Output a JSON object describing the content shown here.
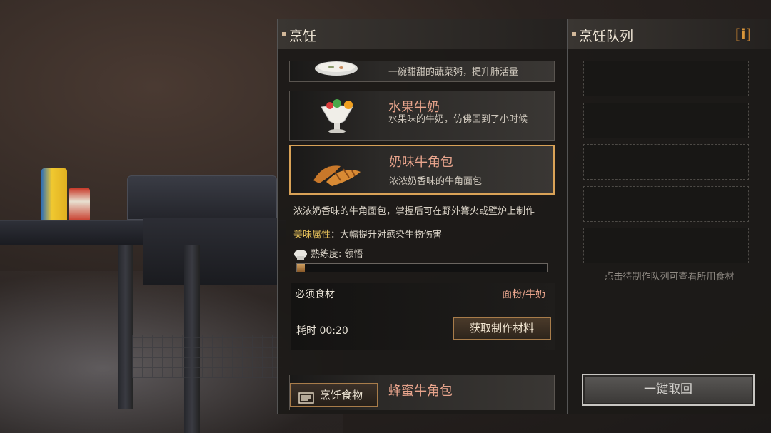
{
  "cooking_panel": {
    "title": "烹饪",
    "recipes": [
      {
        "name": "",
        "description": "一碗甜甜的蔬菜粥，提升肺活量",
        "icon": "porridge-bowl-icon"
      },
      {
        "name": "水果牛奶",
        "description": "水果味的牛奶，仿佛回到了小时候",
        "icon": "fruit-milk-icon"
      },
      {
        "name": "奶味牛角包",
        "description": "浓浓奶香味的牛角面包",
        "icon": "croissant-icon",
        "selected": true
      },
      {
        "name": "蜂蜜牛角包",
        "description": "",
        "icon": "honey-croissant-icon"
      }
    ],
    "detail": {
      "text": "浓浓奶香味的牛角面包，掌握后可在野外篝火或壁炉上制作",
      "attribute_label": "美味属性",
      "attribute_value": "：大幅提升对感染生物伤害",
      "skill_text": "熟练度: 领悟",
      "progress": 0.03
    },
    "ingredients": {
      "label": "必须食材",
      "value": "面粉/牛奶",
      "time": "耗时 00:20",
      "get_button": "获取制作材料"
    },
    "cook_button": "烹饪食物"
  },
  "queue_panel": {
    "title": "烹饪队列",
    "info_icon": "i",
    "slot_count": 5,
    "hint": "点击待制作队列可查看所用食材",
    "recall_button": "一键取回"
  },
  "colors": {
    "accent": "#d9a257",
    "recipe_name": "#e8a48c",
    "attribute_key": "#e6c15a"
  }
}
